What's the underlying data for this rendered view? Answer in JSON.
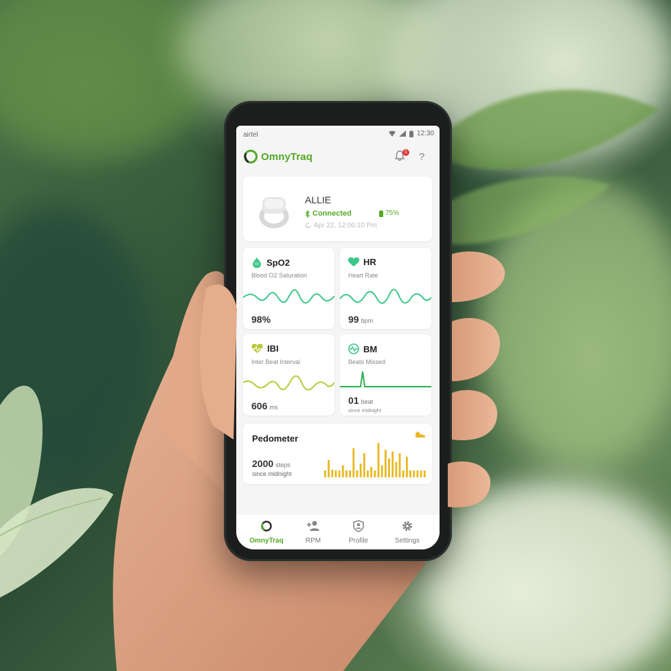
{
  "status_bar": {
    "carrier": "airtel",
    "time": "12:30"
  },
  "app": {
    "name": "OmnyTraq",
    "notification_count": "1",
    "help": "?"
  },
  "device": {
    "name": "ALLIE",
    "status": "Connected",
    "battery": "75%",
    "last_sync": "Apr 22, 12:00:10 Pm"
  },
  "metrics": {
    "spo2": {
      "title": "SpO2",
      "subtitle": "Blood O2 Saturation",
      "value": "98%",
      "icon_label": "O2"
    },
    "hr": {
      "title": "HR",
      "subtitle": "Heart Rate",
      "value": "99",
      "unit": "bpm"
    },
    "ibi": {
      "title": "IBI",
      "subtitle": "Inter Beat Interval",
      "value": "606",
      "unit": "ms"
    },
    "bm": {
      "title": "BM",
      "subtitle": "Beats Missed",
      "value": "01",
      "unit": "beat",
      "note": "since midnight"
    }
  },
  "pedometer": {
    "title": "Pedometer",
    "value": "2000",
    "unit": "steps",
    "note": "since midnight",
    "bars": [
      0.2,
      0.5,
      0.22,
      0.2,
      0.2,
      0.35,
      0.2,
      0.2,
      0.85,
      0.2,
      0.4,
      0.7,
      0.2,
      0.3,
      0.2,
      1.0,
      0.35,
      0.8,
      0.55,
      0.75,
      0.45,
      0.7,
      0.2,
      0.6,
      0.2,
      0.2,
      0.2,
      0.2,
      0.2
    ]
  },
  "nav": [
    {
      "label": "OmnyTraq",
      "active": true
    },
    {
      "label": "RPM",
      "active": false
    },
    {
      "label": "Profile",
      "active": false
    },
    {
      "label": "Settings",
      "active": false
    }
  ],
  "colors": {
    "brand_green": "#53a826",
    "wave_green": "#3cc68a",
    "ibi_yellow": "#b9c93a",
    "bar_yellow": "#e8b820",
    "badge_red": "#e23c3c"
  },
  "icons": [
    "notification-bell-icon",
    "help-icon",
    "bluetooth-icon",
    "battery-icon",
    "sync-icon",
    "droplet-icon",
    "heart-icon",
    "heart-pulse-icon",
    "pulse-circle-icon",
    "shoe-icon",
    "add-user-icon",
    "profile-shield-icon",
    "gear-icon"
  ]
}
